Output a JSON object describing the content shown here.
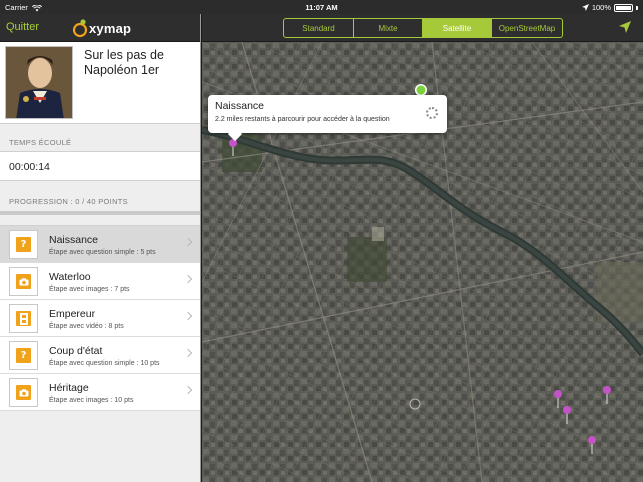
{
  "status_bar": {
    "carrier": "Carrier",
    "time": "11:07 AM",
    "battery": "100%",
    "wifi_icon": "wifi-icon",
    "location_icon": "location-arrow-icon"
  },
  "sidebar": {
    "quit_label": "Quitter",
    "logo_text": "xymap",
    "tour_title": "Sur les pas de Napoléon 1er",
    "elapsed_label": "TEMPS ÉCOULÉ",
    "elapsed_value": "00:00:14",
    "progression_label": "PROGRESSION : 0 / 40 POINTS",
    "progress_fraction": 0,
    "steps": [
      {
        "title": "Naissance",
        "subtitle": "Étape avec question simple : 5 pts",
        "icon": "question-icon",
        "active": true
      },
      {
        "title": "Waterloo",
        "subtitle": "Étape avec images : 7 pts",
        "icon": "camera-icon",
        "active": false
      },
      {
        "title": "Empereur",
        "subtitle": "Étape avec vidéo : 8 pts",
        "icon": "film-icon",
        "active": false
      },
      {
        "title": "Coup d'état",
        "subtitle": "Étape avec question simple : 10 pts",
        "icon": "question-icon",
        "active": false
      },
      {
        "title": "Héritage",
        "subtitle": "Étape avec images : 10 pts",
        "icon": "camera-icon",
        "active": false
      }
    ]
  },
  "map": {
    "map_types": [
      "Standard",
      "Mixte",
      "Satellite",
      "OpenStreetMap"
    ],
    "selected_map_type": "Satellite",
    "callout": {
      "title": "Naissance",
      "subtitle": "2.2 miles restants à parcourir pour accéder à la question"
    },
    "colors": {
      "accent": "#a6c93a",
      "pin": "#c553c8",
      "user_location": "#7bd23a"
    }
  }
}
